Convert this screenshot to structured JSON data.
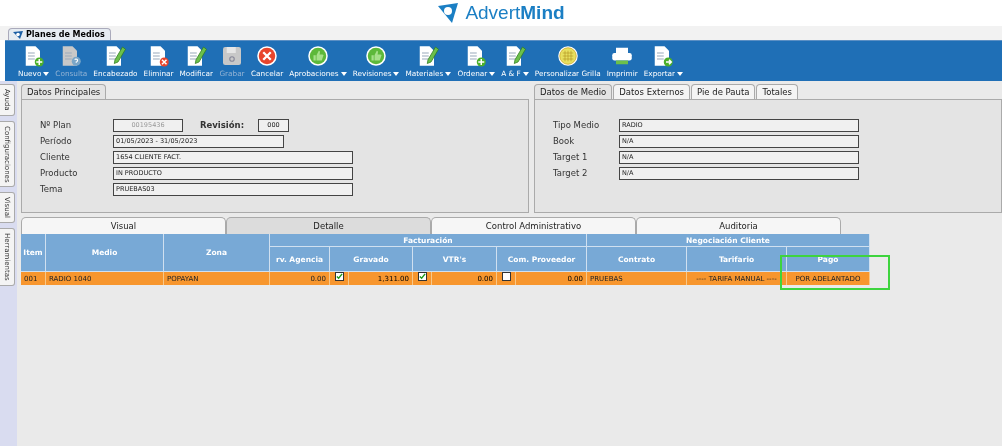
{
  "logo": {
    "text": "Advert**Mind**"
  },
  "window_tab": {
    "title": "Planes de Medios"
  },
  "toolbar": [
    {
      "label": "Nuevo",
      "kind": "doc-plus",
      "disabled": false,
      "dropdown": true
    },
    {
      "label": "Consulta",
      "kind": "doc-question",
      "disabled": true,
      "dropdown": false
    },
    {
      "label": "Encabezado",
      "kind": "doc-pencil",
      "disabled": false,
      "dropdown": false
    },
    {
      "label": "Eliminar",
      "kind": "doc-x",
      "disabled": false,
      "dropdown": false
    },
    {
      "label": "Modificar",
      "kind": "doc-pencil",
      "disabled": false,
      "dropdown": false
    },
    {
      "label": "Grabar",
      "kind": "floppy",
      "disabled": true,
      "dropdown": false
    },
    {
      "label": "Cancelar",
      "kind": "cancel",
      "disabled": false,
      "dropdown": false
    },
    {
      "label": "Aprobaciones",
      "kind": "thumb",
      "disabled": false,
      "dropdown": true
    },
    {
      "label": "Revisiones",
      "kind": "thumb",
      "disabled": false,
      "dropdown": true
    },
    {
      "label": "Materiales",
      "kind": "doc-pencil",
      "disabled": false,
      "dropdown": true
    },
    {
      "label": "Ordenar",
      "kind": "doc-plus",
      "disabled": false,
      "dropdown": true
    },
    {
      "label": "A & F",
      "kind": "doc-pencil",
      "disabled": false,
      "dropdown": true
    },
    {
      "label": "Personalizar Grilla",
      "kind": "grid",
      "disabled": false,
      "dropdown": false
    },
    {
      "label": "Imprimir",
      "kind": "printer",
      "disabled": false,
      "dropdown": false
    },
    {
      "label": "Exportar",
      "kind": "doc-arrow",
      "disabled": false,
      "dropdown": true
    }
  ],
  "side_tabs": [
    "Ayuda",
    "Configuraciones",
    "Visual",
    "Herramientas"
  ],
  "datos_principales": {
    "tab": "Datos Principales",
    "plan_label": "Nº Plan",
    "plan_value": "00195436",
    "revision_label": "Revisión:",
    "revision_value": "000",
    "fields": [
      {
        "label": "Período",
        "value": "01/05/2023 - 31/05/2023"
      },
      {
        "label": "Cliente",
        "value": "1654 CLIENTE FACT."
      },
      {
        "label": "Producto",
        "value": "IN PRODUCTO"
      },
      {
        "label": "Tema",
        "value": "PRUEBAS03"
      }
    ]
  },
  "datos_medio": {
    "tabs": [
      {
        "label": "Datos de Medio",
        "selected": true
      },
      {
        "label": "Datos Externos",
        "selected": false
      },
      {
        "label": "Pie de Pauta",
        "selected": false
      },
      {
        "label": "Totales",
        "selected": false
      }
    ],
    "fields": [
      {
        "label": "Tipo Medio",
        "value": "RADIO"
      },
      {
        "label": "Book",
        "value": "N/A"
      },
      {
        "label": "Target 1",
        "value": "N/A"
      },
      {
        "label": "Target 2",
        "value": "N/A"
      }
    ]
  },
  "detail_tabs": [
    {
      "label": "Visual",
      "selected": false
    },
    {
      "label": "Detalle",
      "selected": true
    },
    {
      "label": "Control Administrativo",
      "selected": false
    },
    {
      "label": "Auditoria",
      "selected": false
    }
  ],
  "table": {
    "groups": [
      "Facturación",
      "Negociación Cliente"
    ],
    "columns": [
      "Item",
      "Medio",
      "Zona",
      "rv. Agencia",
      "Gravado",
      "VTR's",
      "Com. Proveedor",
      "Contrato",
      "Tarifario",
      "Pago"
    ],
    "rows": [
      {
        "selected": true,
        "item": "001",
        "medio": "RADIO 1040",
        "zona": "POPAYAN",
        "agencia": "0.00",
        "gravado_checked": true,
        "gravado": "1,311.00",
        "vtrs_checked": true,
        "vtrs": "0.00",
        "com_proveedor_checked": false,
        "com_proveedor": "0.00",
        "contrato": "PRUEBAS",
        "tarifario": "---- TARIFA MANUAL ----",
        "pago": "POR ADELANTADO"
      }
    ]
  }
}
